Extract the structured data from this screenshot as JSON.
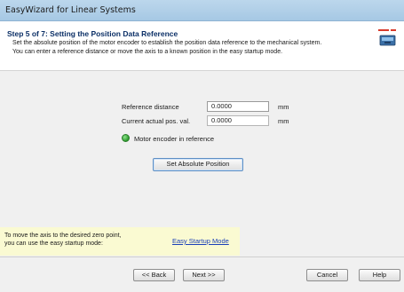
{
  "window": {
    "title": "EasyWizard for Linear Systems"
  },
  "header": {
    "step_title": "Step 5 of 7: Setting the Position Data Reference",
    "description_line1": "Set the absolute position of the motor encoder to establish the position data reference to the mechanical system.",
    "description_line2": "You can enter a reference distance or move the axis to a known position in the easy startup mode."
  },
  "fields": {
    "reference_distance": {
      "label": "Reference distance",
      "value": "0.0000",
      "unit": "mm"
    },
    "current_actual_pos": {
      "label": "Current actual pos. val.",
      "value": "0.0000",
      "unit": "mm"
    }
  },
  "status": {
    "label": "Motor encoder in reference",
    "color": "#2c9c2c"
  },
  "actions": {
    "set_absolute_position": "Set Absolute Position"
  },
  "hint": {
    "line1": "To move the axis to the desired zero point,",
    "line2": "you can use the easy startup mode:",
    "link": "Easy Startup Mode"
  },
  "footer": {
    "back": "<< Back",
    "next": "Next >>",
    "cancel": "Cancel",
    "help": "Help"
  },
  "colors": {
    "title_bar": "#bcd7ec",
    "step_title": "#0b2f66",
    "hint_background": "#fafad2",
    "link": "#1a3fb8"
  },
  "icons": {
    "wizard": "wizard-icon",
    "status_led": "status-led-icon"
  }
}
